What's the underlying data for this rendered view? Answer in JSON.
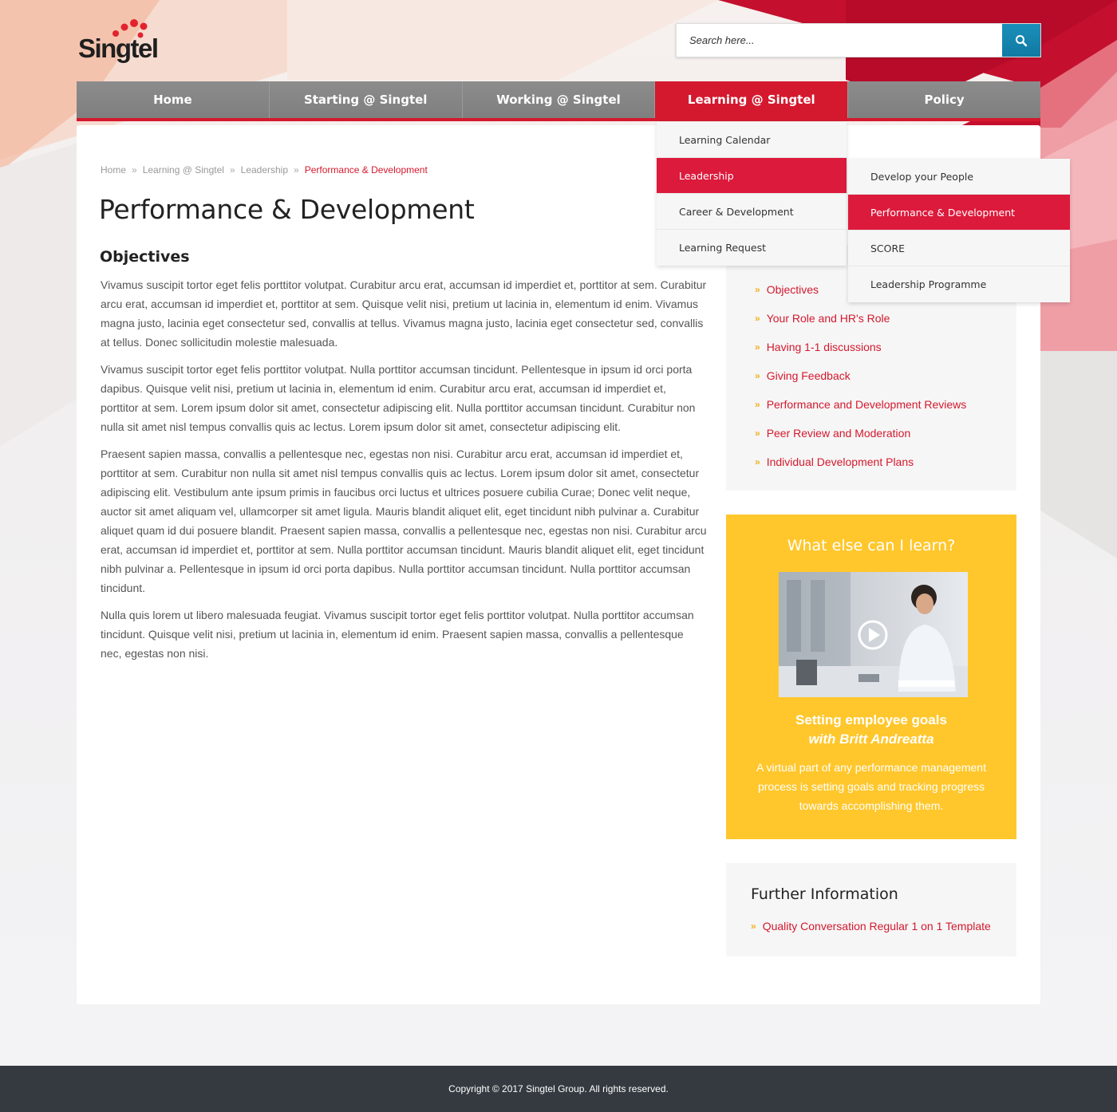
{
  "brand": {
    "logo_text": "Singtel",
    "accent_color": "#d4192e",
    "search_button_color": "#1a8fba"
  },
  "search": {
    "placeholder": "Search here..."
  },
  "nav": {
    "items": [
      {
        "label": "Home"
      },
      {
        "label": "Starting @ Singtel"
      },
      {
        "label": "Working @ Singtel"
      },
      {
        "label": "Learning @ Singtel",
        "active": true
      },
      {
        "label": "Policy"
      }
    ]
  },
  "dropdown": {
    "level1": [
      {
        "label": "Learning Calendar"
      },
      {
        "label": "Leadership",
        "active": true
      },
      {
        "label": "Career & Development"
      },
      {
        "label": "Learning Request"
      }
    ],
    "level2": [
      {
        "label": "Develop your People"
      },
      {
        "label": "Performance & Development",
        "active": true
      },
      {
        "label": "SCORE"
      },
      {
        "label": "Leadership Programme"
      }
    ]
  },
  "breadcrumb": {
    "items": [
      "Home",
      "Learning @ Singtel",
      "Leadership"
    ],
    "current": "Performance & Development"
  },
  "page": {
    "title": "Performance & Development",
    "section_title": "Objectives",
    "paragraphs": [
      "Vivamus suscipit tortor eget felis porttitor volutpat. Curabitur arcu erat, accumsan id imperdiet et, porttitor at sem. Curabitur arcu erat, accumsan id imperdiet et, porttitor at sem. Quisque velit nisi, pretium ut lacinia in, elementum id enim. Vivamus magna justo, lacinia eget consectetur sed, convallis at tellus. Vivamus magna justo, lacinia eget consectetur sed, convallis at tellus. Donec sollicitudin molestie malesuada.",
      "Vivamus suscipit tortor eget felis porttitor volutpat. Nulla porttitor accumsan tincidunt. Pellentesque in ipsum id orci porta dapibus. Quisque velit nisi, pretium ut lacinia in, elementum id enim. Curabitur arcu erat, accumsan id imperdiet et, porttitor at sem. Lorem ipsum dolor sit amet, consectetur adipiscing elit. Nulla porttitor accumsan tincidunt. Curabitur non nulla sit amet nisl tempus convallis quis ac lectus. Lorem ipsum dolor sit amet, consectetur adipiscing elit.",
      "Praesent sapien massa, convallis a pellentesque nec, egestas non nisi. Curabitur arcu erat, accumsan id imperdiet et, porttitor at sem. Curabitur non nulla sit amet nisl tempus convallis quis ac lectus. Lorem ipsum dolor sit amet, consectetur adipiscing elit. Vestibulum ante ipsum primis in faucibus orci luctus et ultrices posuere cubilia Curae; Donec velit neque, auctor sit amet aliquam vel, ullamcorper sit amet ligula. Mauris blandit aliquet elit, eget tincidunt nibh pulvinar a. Curabitur aliquet quam id dui posuere blandit. Praesent sapien massa, convallis a pellentesque nec, egestas non nisi. Curabitur arcu erat, accumsan id imperdiet et, porttitor at sem. Nulla porttitor accumsan tincidunt. Mauris blandit aliquet elit, eget tincidunt nibh pulvinar a. Pellentesque in ipsum id orci porta dapibus. Nulla porttitor accumsan tincidunt. Nulla porttitor accumsan tincidunt.",
      "Nulla quis lorem ut libero malesuada feugiat. Vivamus suscipit tortor eget felis porttitor volutpat. Nulla porttitor accumsan tincidunt. Quisque velit nisi, pretium ut lacinia in, elementum id enim. Praesent sapien massa, convallis a pellentesque nec, egestas non nisi."
    ]
  },
  "toc": {
    "items": [
      "Objectives",
      "Your Role and HR's Role",
      "Having 1-1 discussions",
      "Giving Feedback",
      "Performance and Development Reviews",
      "Peer Review and Moderation",
      "Individual Development Plans"
    ]
  },
  "learn": {
    "title": "What else can I learn?",
    "video_title": "Setting employee goals",
    "video_author": "with Britt Andreatta",
    "description": "A virtual part of any performance management process is setting goals and tracking progress towards accomplishing them.",
    "bg_color": "#ffc72c"
  },
  "further": {
    "title": "Further Information",
    "link": "Quality Conversation Regular 1 on 1 Template"
  },
  "footer": {
    "copyright": "Copyright © 2017 Singtel Group. All rights reserved."
  }
}
